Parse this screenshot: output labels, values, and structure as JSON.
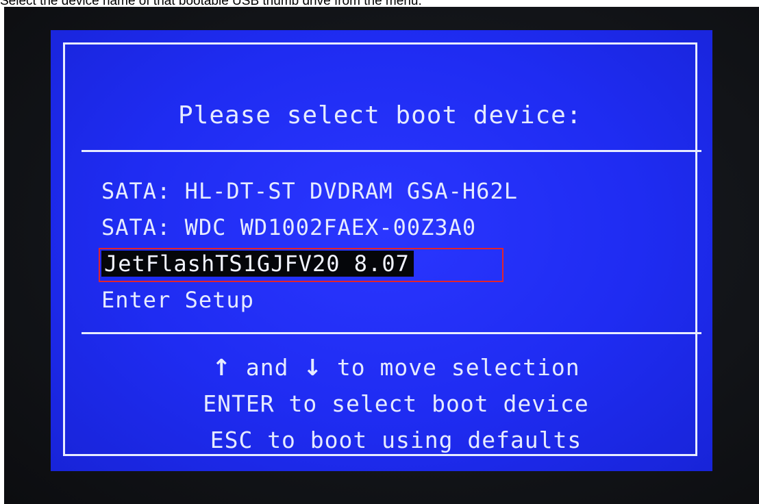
{
  "caption": "Select the device name of that bootable USB thumb drive from the menu.",
  "boot_menu": {
    "title": "Please select boot device:",
    "devices": [
      {
        "label": "SATA: HL-DT-ST DVDRAM GSA-H62L"
      },
      {
        "label": "SATA: WDC WD1002FAEX-00Z3A0"
      },
      {
        "label": "JetFlashTS1GJFV20 8.07",
        "selected": true
      },
      {
        "label": "Enter Setup"
      }
    ],
    "help": {
      "up_icon": "arrow-up-icon",
      "up_glyph": "↑",
      "and_text": " and ",
      "down_icon": "arrow-down-icon",
      "down_glyph": "↓",
      "move_text": " to move selection",
      "enter_line": "ENTER to select boot device",
      "esc_line": "ESC to boot using defaults"
    }
  },
  "colors": {
    "bios_background": "#1f2cf2",
    "bios_text": "#e6ebff",
    "selection_background": "#05060a",
    "annotation_outline": "#e3242b"
  }
}
